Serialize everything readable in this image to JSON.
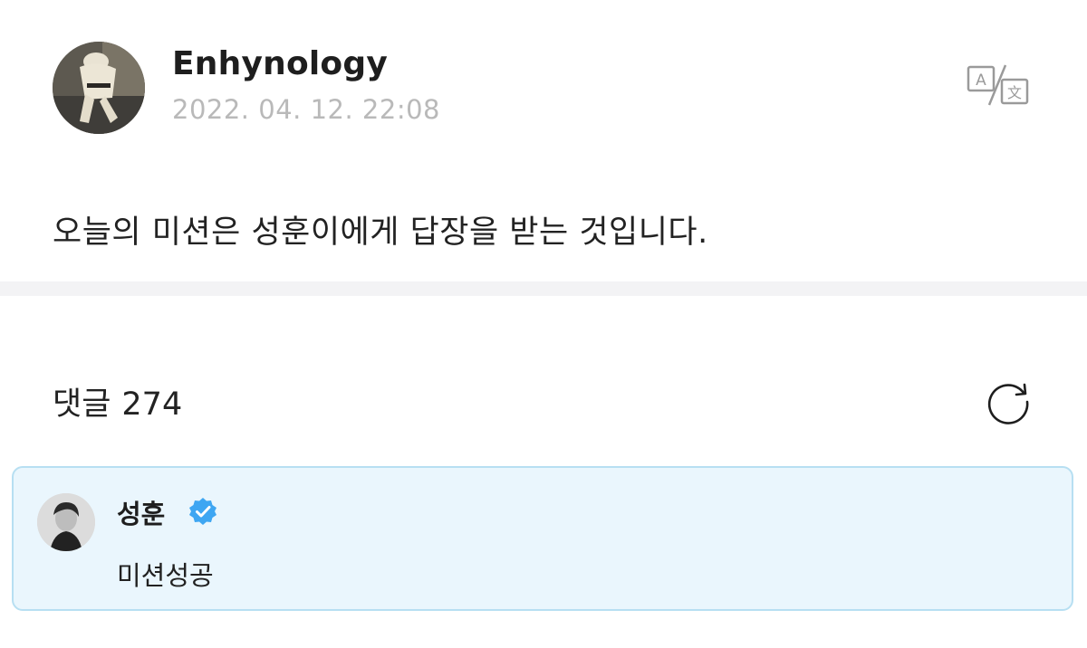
{
  "post": {
    "author_name": "Enhynology",
    "date": "2022. 04. 12. 22:08",
    "body": "오늘의 미션은 성훈이에게 답장을 받는 것입니다.",
    "translate_icon": "translate-icon"
  },
  "comments": {
    "label": "댓글",
    "count": "274",
    "refresh_icon": "refresh-icon",
    "items": [
      {
        "author": "성훈",
        "verified": true,
        "text": "미션성공"
      }
    ]
  },
  "colors": {
    "highlight_bg": "#eaf6fd",
    "highlight_border": "#b7dff2",
    "verified_blue": "#3ea6f2",
    "date_gray": "#b9b9b9"
  }
}
